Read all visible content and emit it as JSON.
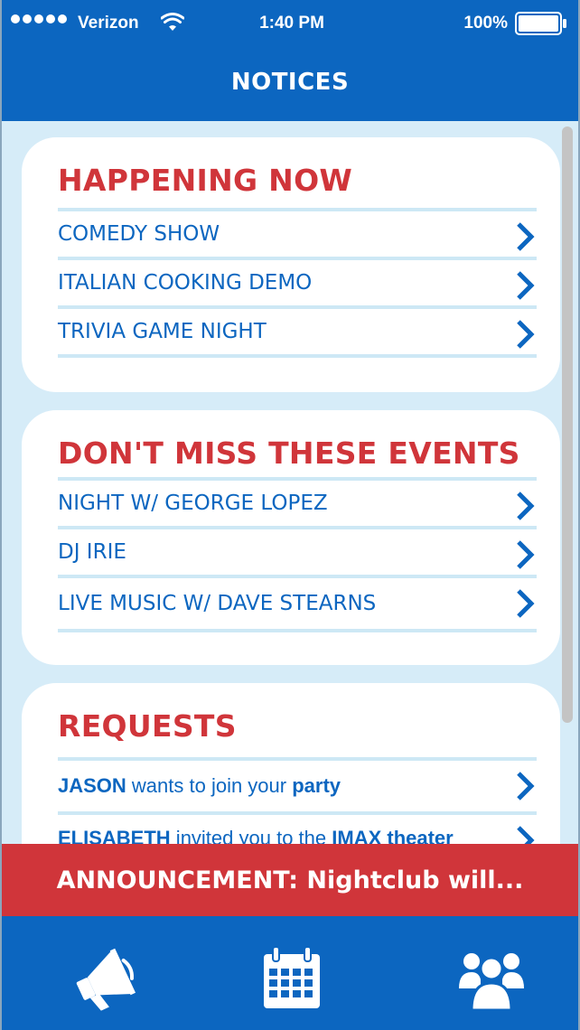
{
  "status_bar": {
    "carrier": "Verizon",
    "time": "1:40 PM",
    "battery": "100%"
  },
  "nav": {
    "title": "NOTICES"
  },
  "happening_now": {
    "title": "HAPPENING NOW",
    "items": [
      {
        "label": "COMEDY SHOW"
      },
      {
        "label": "ITALIAN COOKING DEMO"
      },
      {
        "label": "TRIVIA GAME NIGHT"
      }
    ]
  },
  "events": {
    "title": "DON'T MISS THESE EVENTS",
    "items": [
      {
        "label": "NIGHT W/ GEORGE LOPEZ"
      },
      {
        "label": "DJ IRIE"
      },
      {
        "label": "LIVE MUSIC W/ DAVE STEARNS"
      }
    ]
  },
  "requests": {
    "title": "REQUESTS",
    "items": [
      {
        "name": "JASON",
        "text": " wants to join your ",
        "target": "party"
      },
      {
        "name": "ELISABETH",
        "text": " invited you to the ",
        "target": "IMAX theater"
      }
    ]
  },
  "announcement": {
    "text": "ANNOUNCEMENT: Nightclub will..."
  },
  "tabs": {
    "icons": [
      "megaphone-icon",
      "calendar-icon",
      "group-icon"
    ]
  },
  "colors": {
    "primary": "#0c66c0",
    "accent": "#d0353a",
    "background": "#d6ecf8"
  }
}
